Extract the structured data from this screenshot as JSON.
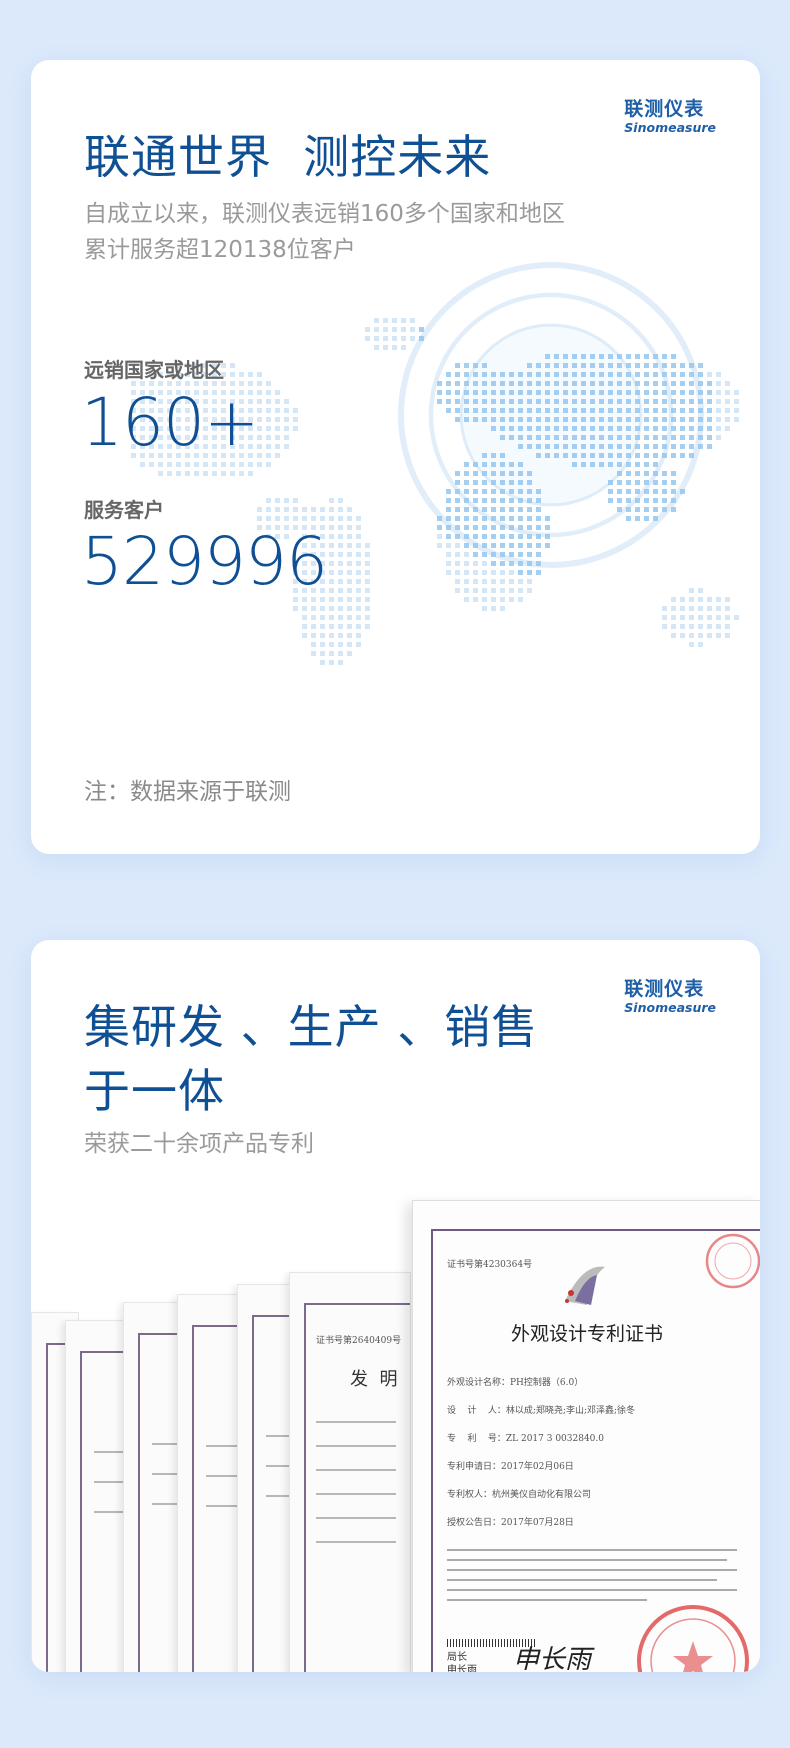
{
  "card1": {
    "logo_cn": "联测仪表",
    "logo_en": "Sinomeasure",
    "headline": "联通世界  测控未来",
    "subtitle_line1": "自成立以来，联测仪表远销160多个国家和地区",
    "subtitle_line2": "累计服务超120138位客户",
    "stats": [
      {
        "label": "远销国家或地区",
        "value": "160+"
      },
      {
        "label": "服务客户",
        "value": "529996"
      }
    ],
    "note": "注：数据来源于联测"
  },
  "card2": {
    "logo_cn": "联测仪表",
    "logo_en": "Sinomeasure",
    "headline_line1": "集研发 、生产 、销售",
    "headline_line2": "于一体",
    "subtitle": "荣获二十余项产品专利",
    "certificate": {
      "number": "证书号第4230364号",
      "title": "外观设计专利证书",
      "fields": [
        "外观设计名称：PH控制器（6.0）",
        "设    计    人：林以成;郑晓尧;李山;邓泽鑫;徐冬",
        "专    利    号：ZL 2017 3 0032840.0",
        "专利申请日：2017年02月06日",
        "专利权人：杭州美仪自动化有限公司",
        "授权公告日：2017年07月28日"
      ],
      "signature_label": "局长\n申长雨",
      "signature": "申长雨"
    },
    "back_docs": {
      "doc_title": "发  明",
      "doc_number": "证书号第2640409号"
    }
  },
  "colors": {
    "brand": "#1f5fa8",
    "headline": "#0f4f93",
    "background": "#dbe9fb"
  }
}
